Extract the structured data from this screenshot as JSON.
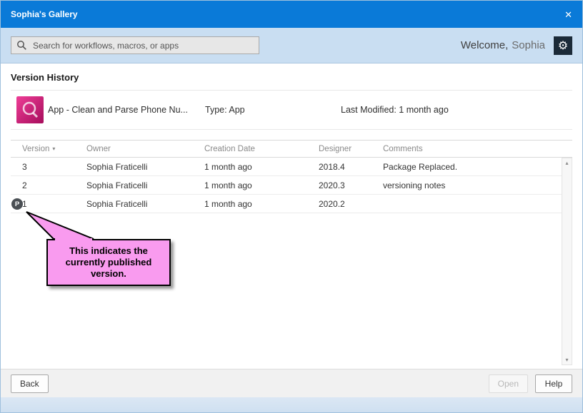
{
  "window": {
    "title": "Sophia's Gallery",
    "close_glyph": "✕"
  },
  "header": {
    "search_placeholder": "Search for workflows, macros, or apps",
    "welcome_prefix": "Welcome,",
    "welcome_name": "Sophia",
    "gear_glyph": "⚙"
  },
  "page": {
    "heading": "Version History"
  },
  "app_info": {
    "name": "App - Clean and Parse Phone Nu...",
    "type": "Type: App",
    "last_modified": "Last Modified: 1 month ago"
  },
  "table": {
    "columns": {
      "version": "Version",
      "owner": "Owner",
      "creation_date": "Creation Date",
      "designer": "Designer",
      "comments": "Comments"
    },
    "sort_glyph": "▾",
    "published_badge": "P",
    "rows": [
      {
        "version": "3",
        "owner": "Sophia Fraticelli",
        "creation_date": "1 month ago",
        "designer": "2018.4",
        "comments": "Package Replaced.",
        "published": false
      },
      {
        "version": "2",
        "owner": "Sophia Fraticelli",
        "creation_date": "1 month ago",
        "designer": "2020.3",
        "comments": "versioning notes",
        "published": false
      },
      {
        "version": "1",
        "owner": "Sophia Fraticelli",
        "creation_date": "1 month ago",
        "designer": "2020.2",
        "comments": "",
        "published": true
      }
    ]
  },
  "callout": {
    "text": "This indicates the currently published version."
  },
  "footer": {
    "back": "Back",
    "open": "Open",
    "help": "Help"
  },
  "scrollbar": {
    "up_glyph": "▴",
    "down_glyph": "▾"
  },
  "colors": {
    "titlebar": "#0a7ad8",
    "header_bg": "#c9def2",
    "callout_bg": "#f99bef",
    "badge_bg": "#4a4f54",
    "app_icon": "#d81b7a"
  }
}
